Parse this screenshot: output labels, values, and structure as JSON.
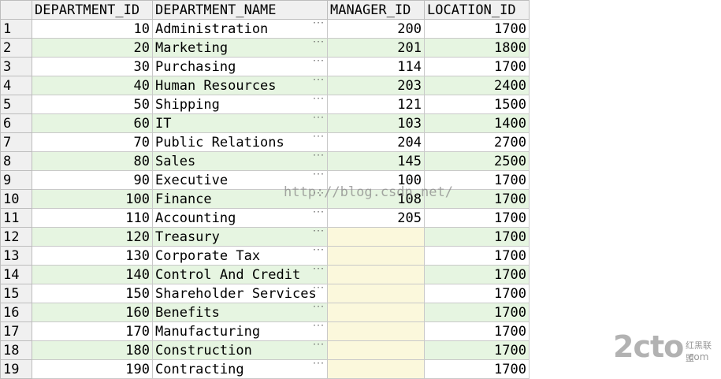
{
  "columns": [
    "DEPARTMENT_ID",
    "DEPARTMENT_NAME",
    "MANAGER_ID",
    "LOCATION_ID"
  ],
  "rows": [
    {
      "n": "1",
      "id": "10",
      "name": "Administration",
      "mgr": "200",
      "loc": "1700"
    },
    {
      "n": "2",
      "id": "20",
      "name": "Marketing",
      "mgr": "201",
      "loc": "1800"
    },
    {
      "n": "3",
      "id": "30",
      "name": "Purchasing",
      "mgr": "114",
      "loc": "1700"
    },
    {
      "n": "4",
      "id": "40",
      "name": "Human Resources",
      "mgr": "203",
      "loc": "2400"
    },
    {
      "n": "5",
      "id": "50",
      "name": "Shipping",
      "mgr": "121",
      "loc": "1500"
    },
    {
      "n": "6",
      "id": "60",
      "name": "IT",
      "mgr": "103",
      "loc": "1400"
    },
    {
      "n": "7",
      "id": "70",
      "name": "Public Relations",
      "mgr": "204",
      "loc": "2700"
    },
    {
      "n": "8",
      "id": "80",
      "name": "Sales",
      "mgr": "145",
      "loc": "2500"
    },
    {
      "n": "9",
      "id": "90",
      "name": "Executive",
      "mgr": "100",
      "loc": "1700"
    },
    {
      "n": "10",
      "id": "100",
      "name": "Finance",
      "mgr": "108",
      "loc": "1700"
    },
    {
      "n": "11",
      "id": "110",
      "name": "Accounting",
      "mgr": "205",
      "loc": "1700"
    },
    {
      "n": "12",
      "id": "120",
      "name": "Treasury",
      "mgr": "",
      "loc": "1700"
    },
    {
      "n": "13",
      "id": "130",
      "name": "Corporate Tax",
      "mgr": "",
      "loc": "1700"
    },
    {
      "n": "14",
      "id": "140",
      "name": "Control And Credit",
      "mgr": "",
      "loc": "1700"
    },
    {
      "n": "15",
      "id": "150",
      "name": "Shareholder Services",
      "mgr": "",
      "loc": "1700"
    },
    {
      "n": "16",
      "id": "160",
      "name": "Benefits",
      "mgr": "",
      "loc": "1700"
    },
    {
      "n": "17",
      "id": "170",
      "name": "Manufacturing",
      "mgr": "",
      "loc": "1700"
    },
    {
      "n": "18",
      "id": "180",
      "name": "Construction",
      "mgr": "",
      "loc": "1700"
    },
    {
      "n": "19",
      "id": "190",
      "name": "Contracting",
      "mgr": "",
      "loc": "1700"
    }
  ],
  "ellipsis": "···",
  "watermark": "http://blog.csdn.net/",
  "logo": {
    "big": "2cto",
    "line1": "红黑联盟",
    "line2": ".com"
  }
}
